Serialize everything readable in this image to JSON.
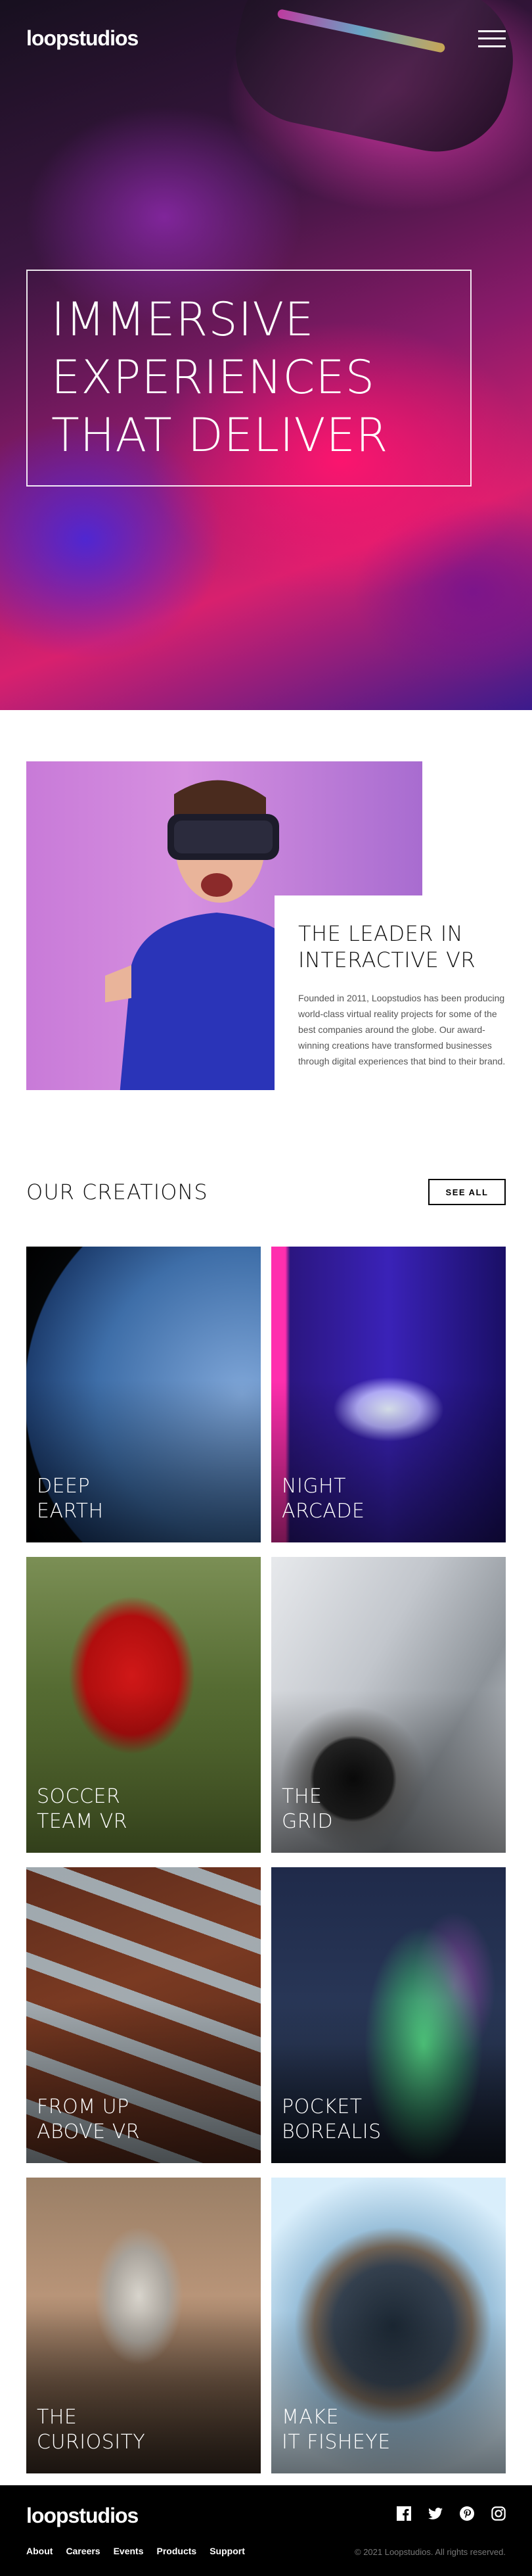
{
  "brand": {
    "logo": "loopstudios"
  },
  "hero": {
    "title": "Immersive\nexperiences\nthat deliver"
  },
  "about": {
    "heading": "The leader in interactive VR",
    "body": "Founded in 2011, Loopstudios has been producing world-class virtual reality projects for some of the best companies around the globe. Our award-winning creations have transformed businesses through digital experiences that bind to their brand."
  },
  "creations": {
    "title": "Our creations",
    "see_all": "SEE ALL",
    "items": [
      {
        "label": "Deep\nearth"
      },
      {
        "label": "Night\narcade"
      },
      {
        "label": "Soccer\nteam VR"
      },
      {
        "label": "The\ngrid"
      },
      {
        "label": "From up\nabove VR"
      },
      {
        "label": "Pocket\nborealis"
      },
      {
        "label": "The\ncuriosity"
      },
      {
        "label": "Make\nit fisheye"
      }
    ]
  },
  "footer": {
    "logo": "loopstudios",
    "nav": [
      "About",
      "Careers",
      "Events",
      "Products",
      "Support"
    ],
    "social_icons": [
      "facebook-icon",
      "twitter-icon",
      "pinterest-icon",
      "instagram-icon"
    ],
    "copyright": "© 2021 Loopstudios. All rights reserved."
  }
}
